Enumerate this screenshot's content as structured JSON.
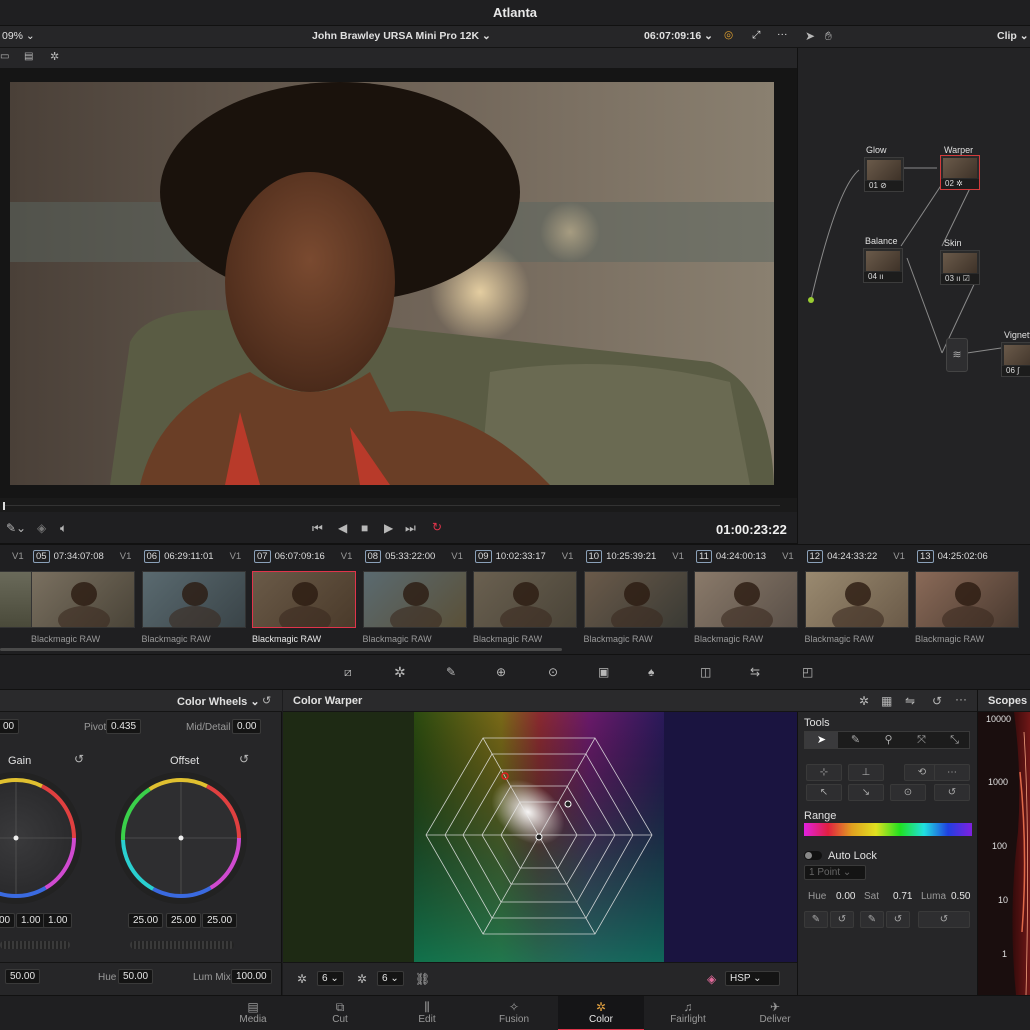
{
  "window": {
    "title": "Atlanta"
  },
  "viewer": {
    "zoom": "09%",
    "clip_title": "John Brawley URSA Mini Pro 12K",
    "timecode_top": "06:07:09:16",
    "timecode": "01:00:23:22"
  },
  "node_editor": {
    "mode": "Clip",
    "nodes": [
      {
        "title": "Glow",
        "label": "01"
      },
      {
        "title": "Warper",
        "label": "02"
      },
      {
        "title": "Balance",
        "label": "04"
      },
      {
        "title": "Skin",
        "label": "03"
      },
      {
        "title": "Vignett",
        "label": "06"
      }
    ]
  },
  "clips": [
    {
      "num": "05",
      "tc": "07:34:07:08",
      "track": "V1",
      "codec": "Blackmagic RAW"
    },
    {
      "num": "06",
      "tc": "06:29:11:01",
      "track": "V1",
      "codec": "Blackmagic RAW"
    },
    {
      "num": "07",
      "tc": "06:07:09:16",
      "track": "V1",
      "codec": "Blackmagic RAW"
    },
    {
      "num": "08",
      "tc": "05:33:22:00",
      "track": "V1",
      "codec": "Blackmagic RAW"
    },
    {
      "num": "09",
      "tc": "10:02:33:17",
      "track": "V1",
      "codec": "Blackmagic RAW"
    },
    {
      "num": "10",
      "tc": "10:25:39:21",
      "track": "V1",
      "codec": "Blackmagic RAW"
    },
    {
      "num": "11",
      "tc": "04:24:00:13",
      "track": "V1",
      "codec": "Blackmagic RAW"
    },
    {
      "num": "12",
      "tc": "04:24:33:22",
      "track": "V1",
      "codec": "Blackmagic RAW"
    },
    {
      "num": "13",
      "tc": "04:25:02:06",
      "track": "V1",
      "codec": "Blackmagic RAW"
    }
  ],
  "clip_lead_track": "V1",
  "color_wheels": {
    "title": "Color Wheels",
    "contrast_value": "00",
    "pivot_label": "Pivot",
    "pivot_value": "0.435",
    "mid_detail_label": "Mid/Detail",
    "mid_detail_value": "0.00",
    "gain_label": "Gain",
    "offset_label": "Offset",
    "gain_values": [
      "00",
      "1.00",
      "1.00"
    ],
    "offset_values": [
      "25.00",
      "25.00",
      "25.00"
    ],
    "sat_value": "50.00",
    "hue_label": "Hue",
    "hue_value": "50.00",
    "lum_mix_label": "Lum Mix",
    "lum_mix_value": "100.00"
  },
  "warper": {
    "title": "Color Warper",
    "grid1": "6",
    "grid2": "6",
    "space": "HSP"
  },
  "tools": {
    "title": "Tools",
    "range_label": "Range",
    "auto_lock": "Auto Lock",
    "point_select": "1 Point",
    "hue_label": "Hue",
    "hue_value": "0.00",
    "sat_label": "Sat",
    "sat_value": "0.71",
    "luma_label": "Luma",
    "luma_value": "0.50"
  },
  "scopes": {
    "title": "Scopes",
    "ticks": [
      "10000",
      "1000",
      "100",
      "10",
      "1"
    ]
  },
  "pages": [
    "Media",
    "Cut",
    "Edit",
    "Fusion",
    "Color",
    "Fairlight",
    "Deliver"
  ],
  "active_page": "Color",
  "colors": {
    "accent": "#e0344b",
    "selected_node": "#d23b3b",
    "connector": "#9acd32"
  }
}
